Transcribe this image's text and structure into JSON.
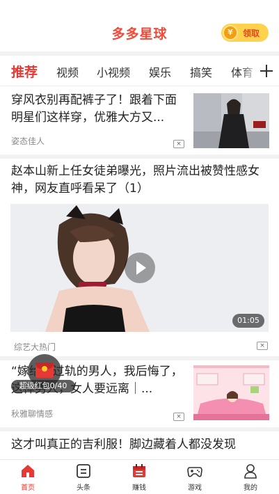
{
  "header": {
    "app_title": "多多星球",
    "claim_label": "领取",
    "coin_symbol": "¥",
    "accent_color": "#ef4b3a"
  },
  "tabs": [
    {
      "label": "推荐",
      "active": true
    },
    {
      "label": "视频",
      "active": false
    },
    {
      "label": "小视频",
      "active": false
    },
    {
      "label": "娱乐",
      "active": false
    },
    {
      "label": "搞笑",
      "active": false
    },
    {
      "label": "体育",
      "active": false
    }
  ],
  "feed": {
    "articles": [
      {
        "title": "穿风衣别再配裤子了！跟着下面明星们这样穿，优雅大方又...",
        "source": "姿态佳人",
        "close_icon": "×"
      },
      {
        "title": "赵本山新上任女徒弟曝光，照片流出被赞性感女神，网友直呼看呆了（1）",
        "source": "综艺大热门",
        "duration": "01:05",
        "close_icon": "×"
      },
      {
        "title": "“嫁给出过轨的男人，我后悔了，这样男人，女人要远离｜...",
        "source": "秋雅聊情感",
        "close_icon": "×"
      },
      {
        "title": "这才叫真正的吉利服！脚边藏着人都没发现"
      }
    ]
  },
  "redpack": {
    "label": "超级红包0/40"
  },
  "bottom_nav": [
    {
      "label": "首页",
      "icon": "home-icon",
      "active": true
    },
    {
      "label": "头条",
      "icon": "headline-icon",
      "active": false
    },
    {
      "label": "赚钱",
      "icon": "calendar-earn-icon",
      "active": false
    },
    {
      "label": "游戏",
      "icon": "gamepad-icon",
      "active": false
    },
    {
      "label": "我的",
      "icon": "profile-icon",
      "active": false
    }
  ]
}
